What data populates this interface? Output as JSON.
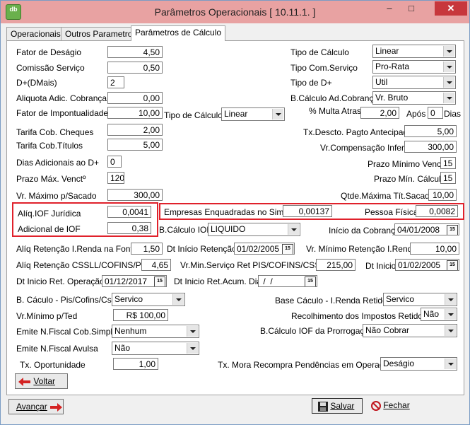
{
  "window": {
    "title": "Parâmetros Operacionais [ 10.11.1. ]",
    "app_icon_text": "db"
  },
  "tabs": [
    {
      "label": "Operacionais"
    },
    {
      "label": "Outros Parametros"
    },
    {
      "label": "Parâmetros de Cálculo"
    }
  ],
  "fields": {
    "fator_desagio": {
      "label": "Fator de Deságio",
      "value": "4,50"
    },
    "comissao_servico": {
      "label": "Comissão Serviço",
      "value": "0,50"
    },
    "d_dmais": {
      "label": "D+(DMais)",
      "value": "2"
    },
    "aliquota_adic": {
      "label": "Aliquota Adic. Cobrança",
      "value": "0,00"
    },
    "fator_impontualidade": {
      "label": "Fator de Impontualidade",
      "value": "10,00"
    },
    "tipo_calculo_mid": {
      "label": "Tipo de Cálculo",
      "value": "Linear"
    },
    "tarifa_cheques": {
      "label": "Tarifa Cob. Cheques",
      "value": "2,00"
    },
    "tarifa_titulos": {
      "label": "Tarifa Cob.Títulos",
      "value": "5,00"
    },
    "dias_adicionais": {
      "label": "Dias Adicionais ao D+",
      "value": "0"
    },
    "prazo_max_venct": {
      "label": "Prazo Máx. Venctº",
      "value": "120"
    },
    "vr_max_sacado": {
      "label": "Vr. Máximo p/Sacado",
      "value": "300,00"
    },
    "aliq_iof_juridica": {
      "label": "Alíq.IOF Jurídica",
      "value": "0,0041"
    },
    "adicional_iof": {
      "label": "Adicional de IOF",
      "value": "0,38"
    },
    "empresas_simples": {
      "label": "Empresas Enquadradas no Simples",
      "value": "0,00137"
    },
    "pessoa_fisica": {
      "label": "Pessoa Física",
      "value": "0,0082"
    },
    "b_calculo_iof": {
      "label": "B.Cálculo IOF",
      "value": "LIQUIDO"
    },
    "inicio_cobranca": {
      "label": "Início da Cobrança",
      "value": "04/01/2008"
    },
    "aliq_ret_ir": {
      "label": "Alíq Retenção I.Renda na Fonte",
      "value": "1,50"
    },
    "dt_inicio_retencao": {
      "label": "Dt Início Retenção",
      "value": "01/02/2005"
    },
    "vr_minimo_retencao": {
      "label": "Vr. Mínimo  Retenção I.Renda",
      "value": "10,00"
    },
    "aliq_ret_csll": {
      "label": "Alíq Retenção CSSLL/COFINS/PIS",
      "value": "4,65"
    },
    "vr_min_servico": {
      "label": "Vr.Min.Serviço Ret PIS/COFINS/CSSL",
      "value": "215,00"
    },
    "dt_inicio_2": {
      "label": "Dt Inicio",
      "value": "01/02/2005"
    },
    "dt_inicio_ret_oper": {
      "label": "Dt Inicio Ret. Operação",
      "value": "01/12/2017"
    },
    "dt_inicio_ret_acum": {
      "label": "Dt Inicio Ret.Acum. Dia",
      "value": " /  / "
    },
    "b_calculo_pis": {
      "label": "B. Cáculo - Pis/Cofins/Cssl",
      "value": "Servico"
    },
    "vr_minimo_ted": {
      "label": "Vr.Mínimo p/Ted",
      "value": "R$ 100,00"
    },
    "emite_nf_simples": {
      "label": "Emite N.Fiscal Cob.Simples",
      "value": "Nenhum"
    },
    "emite_nf_avulsa": {
      "label": "Emite N.Fiscal Avulsa",
      "value": "Não"
    },
    "tx_oportunidade": {
      "label": "Tx. Oportunidade",
      "value": "1,00"
    },
    "tipo_calculo_r": {
      "label": "Tipo de Cálculo",
      "value": "Linear"
    },
    "tipo_com_servico": {
      "label": "Tipo Com.Serviço",
      "value": "Pro-Rata"
    },
    "tipo_d_mais": {
      "label": "Tipo de D+",
      "value": "Util"
    },
    "b_calculo_ad_cobranca": {
      "label": "B.Cálculo Ad.Cobrança",
      "value": "Vr. Bruto"
    },
    "multa_atraso": {
      "label": "% Multa Atraso",
      "value": "2,00"
    },
    "apos": {
      "label": "Após",
      "value": "0"
    },
    "dias": {
      "label": "Dias"
    },
    "tx_descto": {
      "label": "Tx.Descto. Pagto Antecipado",
      "value": "5,00"
    },
    "vr_compensacao": {
      "label": "Vr.Compensação Inferior",
      "value": "300,00"
    },
    "prazo_min_venct": {
      "label": "Prazo Mínimo Venctº",
      "value": "15"
    },
    "prazo_min_calculo": {
      "label": "Prazo Mín. Cálculo",
      "value": "15"
    },
    "qtde_max_tit": {
      "label": "Qtde.Máxima Tít.Sacado",
      "value": "10,00"
    },
    "base_calculo_ir": {
      "label": "Base Cáculo - I.Renda Retido",
      "value": "Servico"
    },
    "recolhimento": {
      "label": "Recolhimento  dos Impostos Retidos",
      "value": "Não"
    },
    "b_calculo_prorrogacao": {
      "label": "B.Cálculo IOF da Prorrogação",
      "value": "Não Cobrar"
    },
    "tx_mora": {
      "label": "Tx. Mora Recompra Pendências em Operações",
      "value": "Deságio"
    }
  },
  "buttons": {
    "voltar": "Voltar",
    "avancar": "Avançar",
    "salvar": "Salvar",
    "fechar": "Fechar"
  },
  "colors": {
    "highlight_border": "#e0212b",
    "titlebar": "#e8a2a2",
    "close": "#c7373c"
  },
  "icons": [
    "app-icon",
    "minimize-icon",
    "maximize-icon",
    "close-icon",
    "calendar-icon",
    "dropdown-arrow-icon",
    "arrow-left-icon",
    "arrow-right-icon",
    "floppy-disk-icon",
    "no-entry-icon"
  ]
}
